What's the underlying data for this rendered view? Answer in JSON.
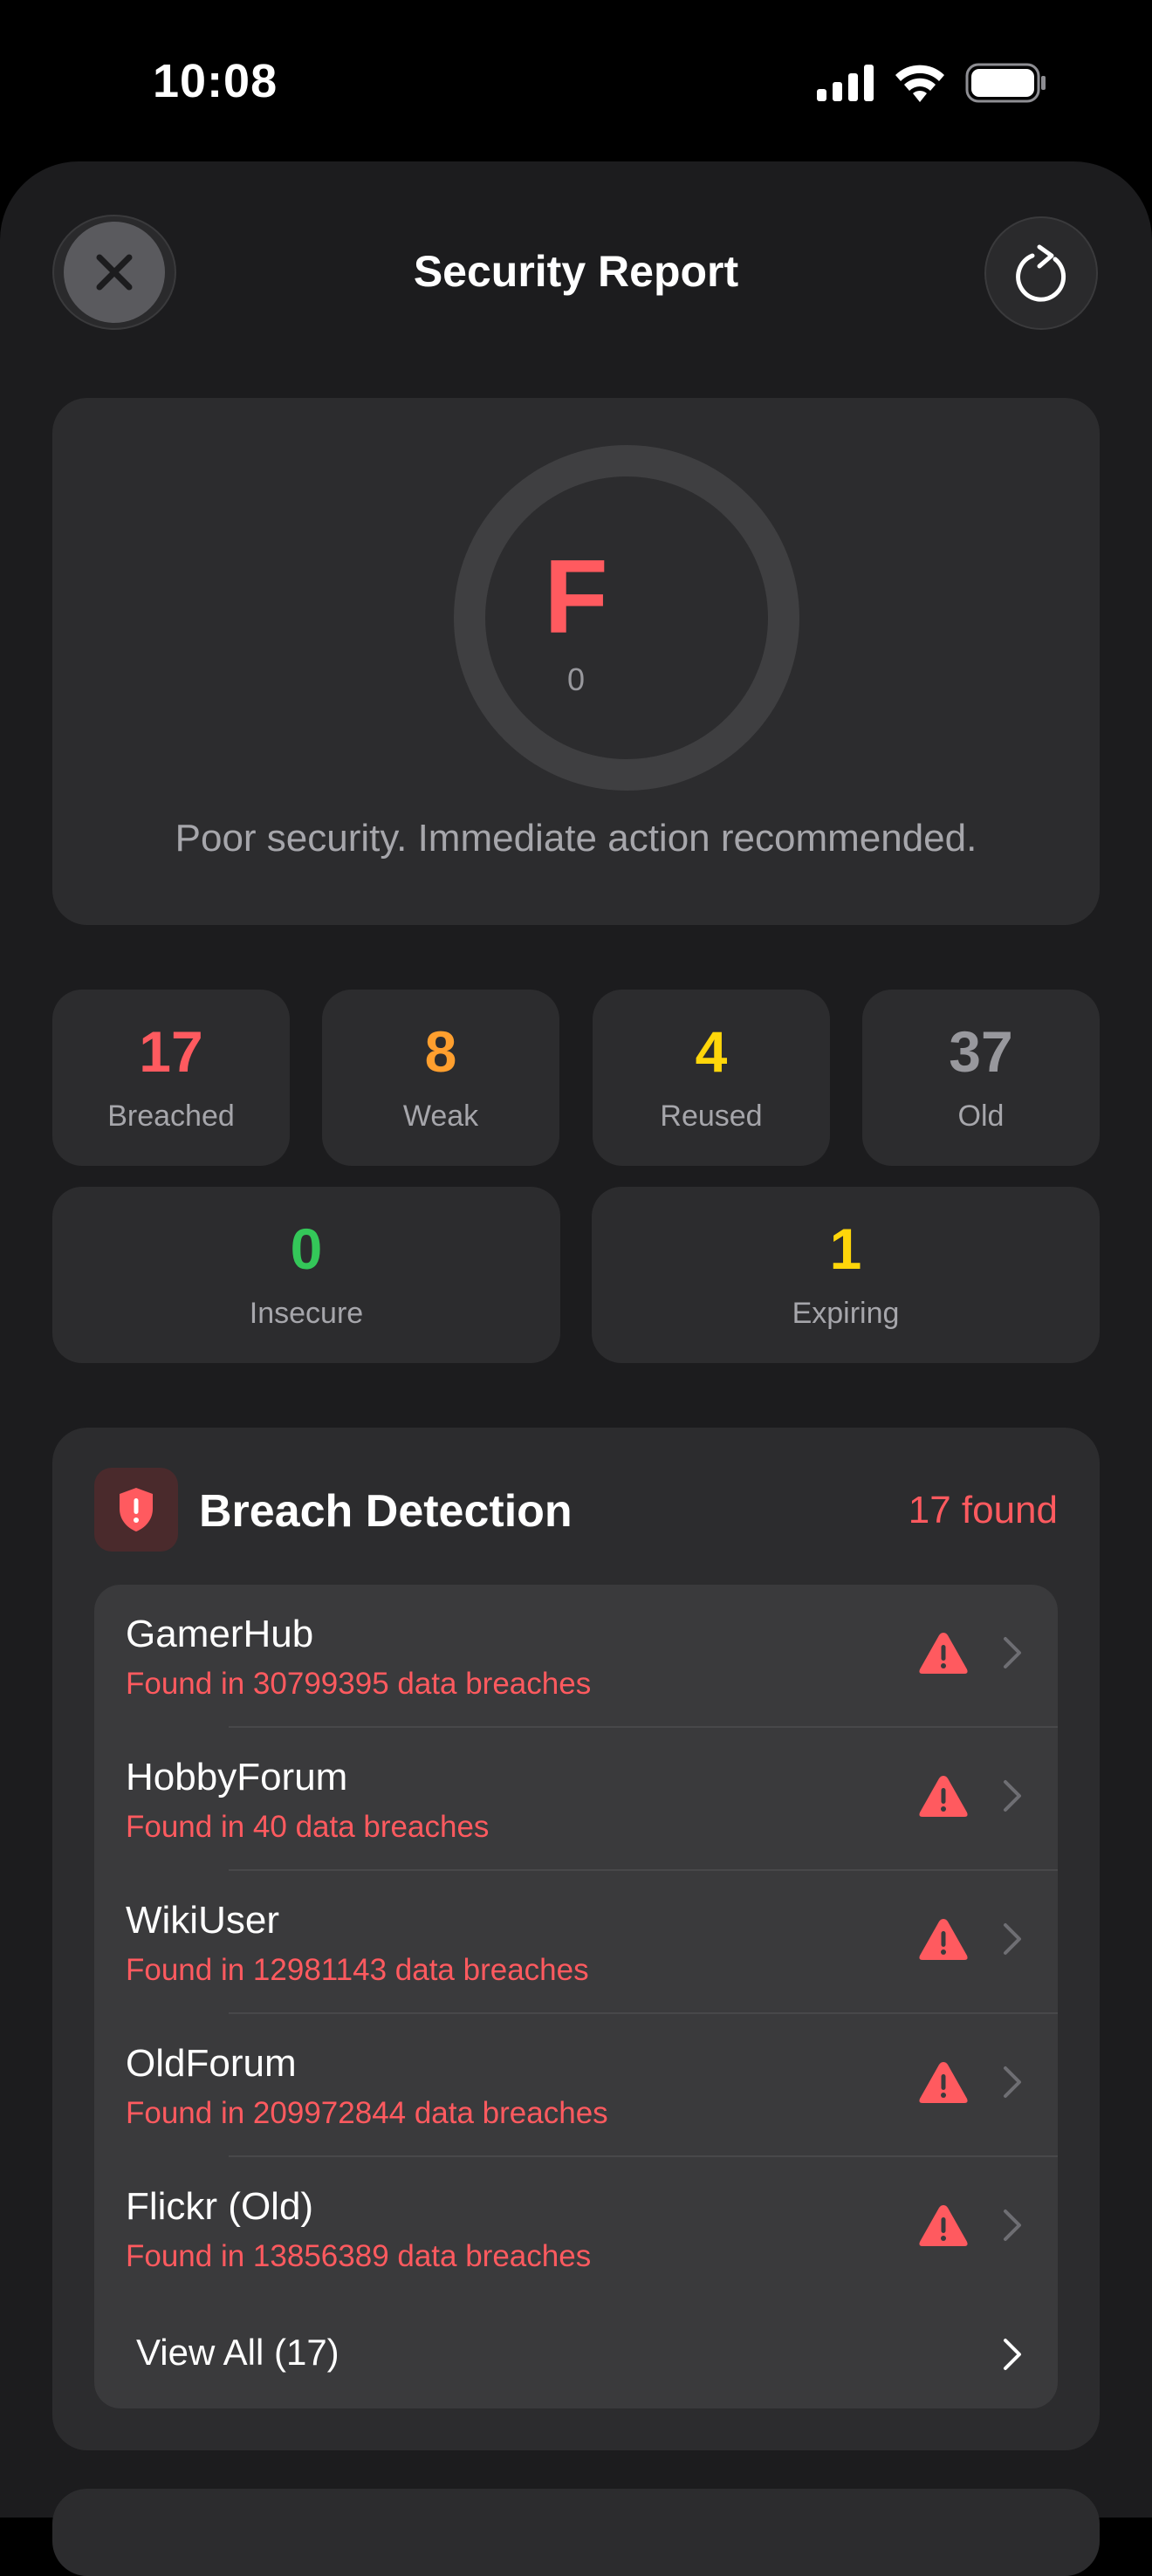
{
  "status_bar": {
    "time": "10:08"
  },
  "header": {
    "title": "Security Report",
    "close_icon": "xmark-icon",
    "refresh_icon": "arrow-clockwise-icon"
  },
  "score": {
    "grade": "F",
    "value": "0",
    "message": "Poor security. Immediate action recommended."
  },
  "stats": [
    {
      "value": "17",
      "label": "Breached",
      "color": "#ff5a5f"
    },
    {
      "value": "8",
      "label": "Weak",
      "color": "#ff9f2e"
    },
    {
      "value": "4",
      "label": "Reused",
      "color": "#ffd60a"
    },
    {
      "value": "37",
      "label": "Old",
      "color": "#98989d"
    },
    {
      "value": "0",
      "label": "Insecure",
      "color": "#34c759"
    },
    {
      "value": "1",
      "label": "Expiring",
      "color": "#ffd60a"
    }
  ],
  "breach": {
    "title": "Breach Detection",
    "count": "17 found",
    "items": [
      {
        "name": "GamerHub",
        "detail": "Found in 30799395 data breaches"
      },
      {
        "name": "HobbyForum",
        "detail": "Found in 40 data breaches"
      },
      {
        "name": "WikiUser",
        "detail": "Found in 12981143 data breaches"
      },
      {
        "name": "OldForum",
        "detail": "Found in 209972844 data breaches"
      },
      {
        "name": "Flickr (Old)",
        "detail": "Found in 13856389 data breaches"
      }
    ],
    "view_all": "View All (17)"
  },
  "colors": {
    "danger": "#ff5a5f",
    "background": "#1c1c1e",
    "card": "#2c2c2e"
  }
}
